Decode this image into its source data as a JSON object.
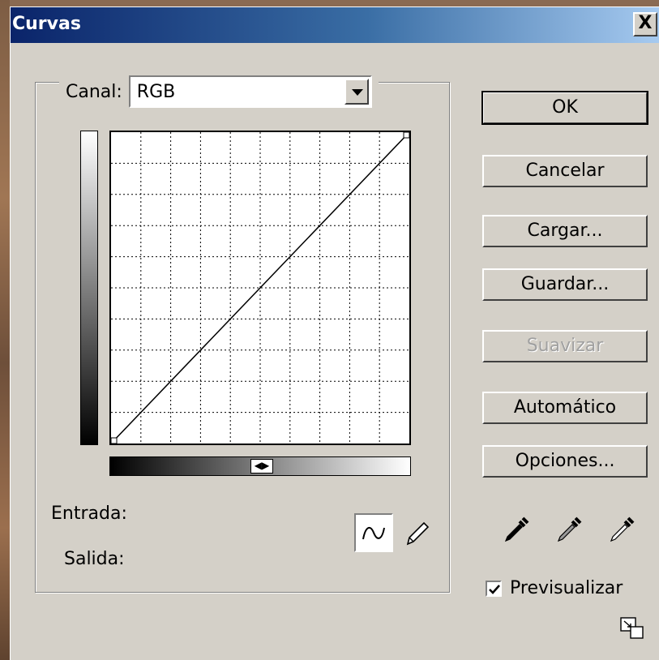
{
  "window": {
    "title": "Curvas",
    "close_label": "X"
  },
  "channel": {
    "label": "Canal:",
    "value": "RGB"
  },
  "readout": {
    "input_label": "Entrada:",
    "output_label": "Salida:"
  },
  "buttons": {
    "ok": "OK",
    "cancel": "Cancelar",
    "load": "Cargar...",
    "save": "Guardar...",
    "smooth": "Suavizar",
    "auto": "Automático",
    "options": "Opciones..."
  },
  "preview": {
    "label": "Previsualizar",
    "checked": true
  },
  "curve": {
    "points": [
      [
        0,
        0
      ],
      [
        255,
        255
      ]
    ],
    "grid_divisions": 10
  },
  "icons": {
    "curve_tool": "curve-tool-icon",
    "pencil_tool": "pencil-icon",
    "black_eyedropper": "black-eyedropper-icon",
    "gray_eyedropper": "gray-eyedropper-icon",
    "white_eyedropper": "white-eyedropper-icon",
    "expand": "expand-dialog-icon",
    "dropdown": "chevron-down-icon",
    "gradient_toggle": "gradient-direction-toggle-icon"
  },
  "colors": {
    "title_start": "#0a246a",
    "title_end": "#a6caf0",
    "dialog_bg": "#d4d0c8",
    "disabled_text": "#a0a0a0"
  }
}
